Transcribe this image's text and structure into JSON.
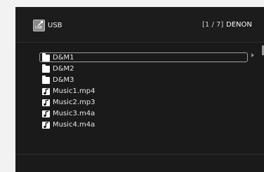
{
  "header": {
    "source_icon": "usb-source-icon",
    "source_icon_text": "USB",
    "source_name": "USB",
    "page_indicator": "[1 / 7]",
    "brand": "DENON"
  },
  "file_list": {
    "items": [
      {
        "label": "D&M1",
        "icon": "folder-icon",
        "selected": true
      },
      {
        "label": "D&M2",
        "icon": "folder-icon",
        "selected": false
      },
      {
        "label": "D&M3",
        "icon": "folder-icon",
        "selected": false
      },
      {
        "label": "Music1.mp4",
        "icon": "music-note-icon",
        "selected": false
      },
      {
        "label": "Music2.mp3",
        "icon": "music-note-icon",
        "selected": false
      },
      {
        "label": "Music3.m4a",
        "icon": "music-note-icon",
        "selected": false
      },
      {
        "label": "Music4.m4a",
        "icon": "music-note-icon",
        "selected": false
      }
    ]
  },
  "colors": {
    "screen_background": "#1a1a1a",
    "page_background": "#f2f2f2",
    "text": "#e6e6e6",
    "selection_border": "#9f9f9f"
  }
}
